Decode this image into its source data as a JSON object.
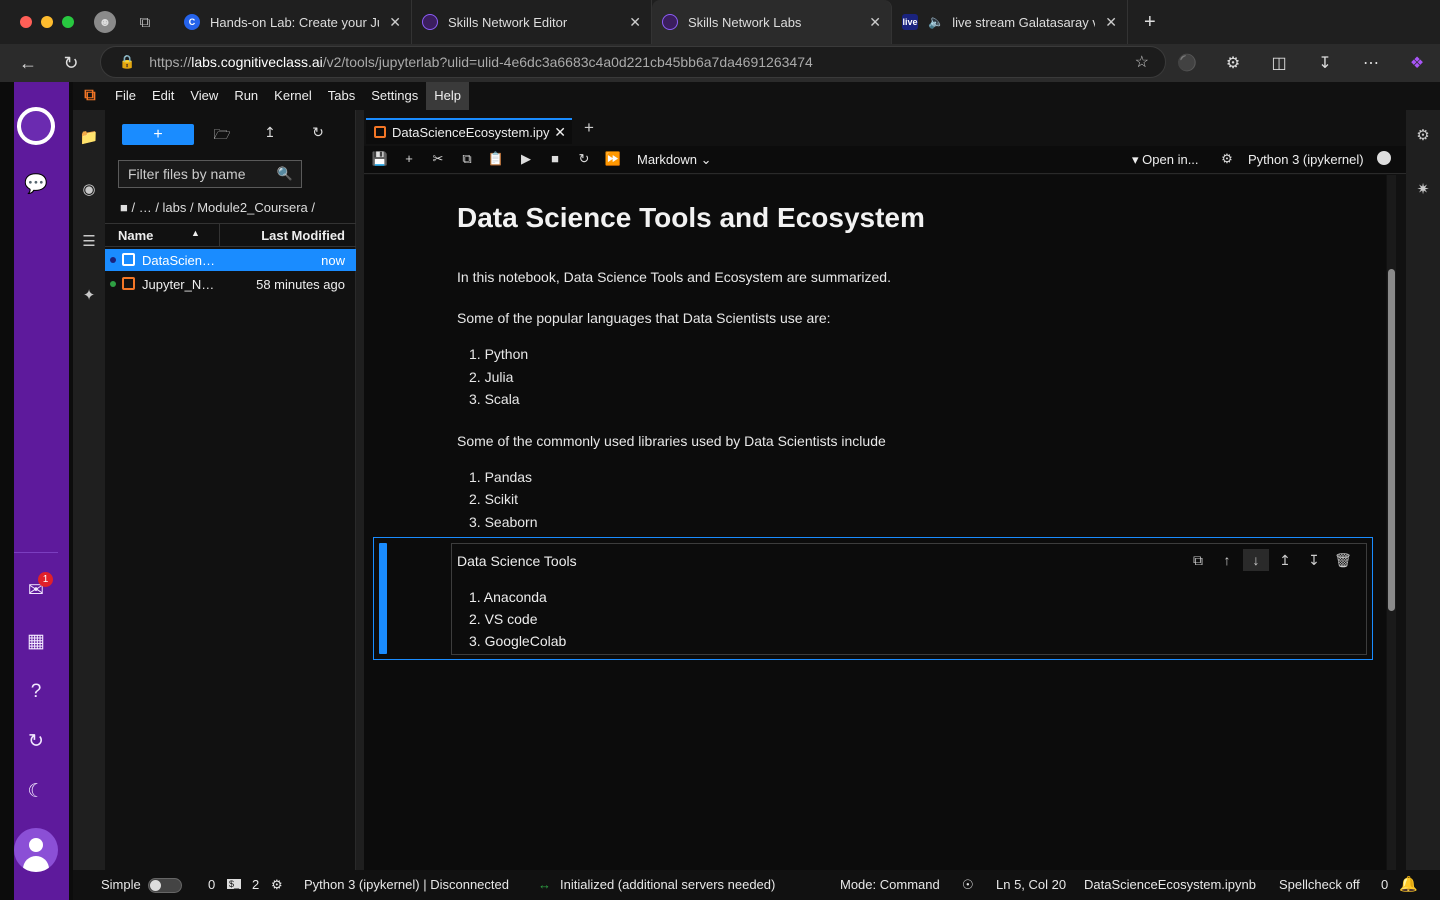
{
  "browser": {
    "tabs": [
      {
        "title": "Hands-on Lab: Create your Jup",
        "favicon_color": "#2563eb",
        "favicon_text": "C"
      },
      {
        "title": "Skills Network Editor",
        "favicon_color": "#5e1a9c",
        "favicon_text": ""
      },
      {
        "title": "Skills Network Labs",
        "favicon_color": "#5e1a9c",
        "favicon_text": ""
      },
      {
        "title": "live stream Galatasaray vs",
        "favicon_color": "#1a237e",
        "favicon_text": "live"
      }
    ],
    "active_tab_index": 2,
    "new_tab_icon": "+",
    "url": {
      "prefix": "https://",
      "host": "labs.cognitiveclass.ai",
      "path": "/v2/tools/jupyterlab?ulid=ulid-4e6dc3a6683c4a0d221cb45bb6a7da4691263474"
    }
  },
  "rail": {
    "notification_count": "1",
    "icons": [
      "chatbot-icon",
      "inbox-icon",
      "news-icon",
      "help-icon",
      "sync-icon",
      "moon-icon",
      "user-icon"
    ]
  },
  "menubar": {
    "items": [
      "File",
      "Edit",
      "View",
      "Run",
      "Kernel",
      "Tabs",
      "Settings",
      "Help"
    ],
    "open_item": "Help"
  },
  "filebrowser": {
    "new_button": "+",
    "filter_placeholder": "Filter files by name",
    "breadcrumbs": "/   …  / labs / Module2_Coursera /",
    "columns": {
      "name": "Name",
      "modified": "Last Modified"
    },
    "files": [
      {
        "name": "DataScienceEcosystem.ipynb",
        "display": "DataScien…",
        "modified": "now",
        "status_color": "#1a237e",
        "selected": true
      },
      {
        "name": "Jupyter_Notebook",
        "display": "Jupyter_N…",
        "modified": "58 minutes ago",
        "status_color": "#2ea043",
        "selected": false
      }
    ]
  },
  "document": {
    "tab_title": "DataScienceEcosystem.ipy",
    "cell_type": "Markdown",
    "open_in": "Open in...",
    "kernel": "Python 3 (ipykernel)"
  },
  "notebook": {
    "title": "Data Science Tools and Ecosystem",
    "intro": "In this notebook, Data Science Tools and Ecosystem are summarized.",
    "languages_intro": "Some of the popular languages that Data Scientists use are:",
    "languages": [
      "1. Python",
      "2. Julia",
      "3. Scala"
    ],
    "libraries_intro": "Some of the commonly used libraries used by Data Scientists include",
    "libraries": [
      "1. Pandas",
      "2. Scikit",
      "3. Seaborn"
    ],
    "active_cell": {
      "text": "Data Science Tools",
      "items": [
        "1. Anaconda",
        "2. VS code",
        "3. GoogleColab"
      ]
    }
  },
  "statusbar": {
    "mode_label": "Simple",
    "terminals": "0",
    "kernels": "2",
    "kernel_status": "Python 3 (ipykernel) | Disconnected",
    "lsp": "Initialized (additional servers needed)",
    "mode": "Mode: Command",
    "position": "Ln 5, Col 20",
    "file": "DataScienceEcosystem.ipynb",
    "spellcheck": "Spellcheck off",
    "notifications": "0"
  }
}
